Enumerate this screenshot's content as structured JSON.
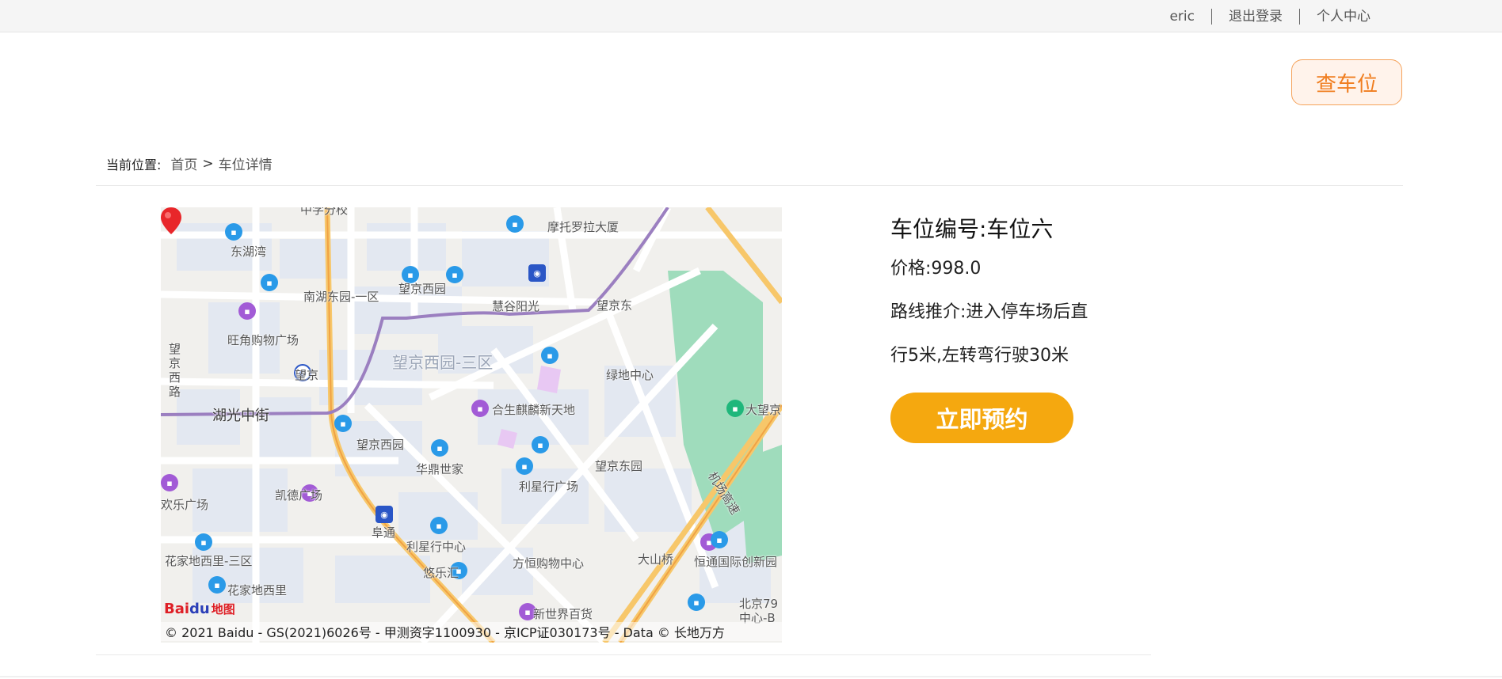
{
  "topbar": {
    "username": "eric",
    "logout": "退出登录",
    "profile": "个人中心"
  },
  "find_button": "查车位",
  "breadcrumb": {
    "label": "当前位置:",
    "home": "首页",
    "separator": ">",
    "current": "车位详情"
  },
  "map": {
    "labels": {
      "donghuwan": "东湖湾",
      "nanhu": "南湖东园-一区",
      "wangjing_xiyuan": "望京西园",
      "huigu": "慧谷阳光",
      "motorola": "摩托罗拉大厦",
      "wangjingdong": "望京东",
      "wangjiao": "旺角购物广场",
      "wangjing_west_road": "望京西路",
      "wangjing": "望京",
      "area_3": "望京西园-三区",
      "lvdi": "绿地中心",
      "huguang": "湖光中街",
      "hesheng": "合生麒麟新天地",
      "dawang": "大望京",
      "wangjing_xiyuan2": "望京西园",
      "huading": "华鼎世家",
      "lixing": "利星行广场",
      "wangjing_dongyuan": "望京东园",
      "jichang": "机场高速",
      "kaide": "凯德广场",
      "huanle": "欢乐广场",
      "futong": "阜通",
      "lixing_center": "利星行中心",
      "fangheng": "方恒购物中心",
      "huajia3": "花家地西里-三区",
      "huajia": "花家地西里",
      "dashanqiao": "大山桥",
      "hengtong": "恒通国际创新园",
      "youlehui": "悠乐汇",
      "xinshijie": "新世界百货",
      "beijing79": "北京79",
      "center_b": "中心-B",
      "zhongxue": "中学分校"
    },
    "logo": {
      "bai": "Bai",
      "du": "du",
      "ditu": "地图"
    },
    "copyright": "© 2021 Baidu - GS(2021)6026号 - 甲测资字1100930 - 京ICP证030173号 - Data © 长地万方"
  },
  "spot": {
    "title": "车位编号:车位六",
    "price": "价格:998.0",
    "route_line1": "路线推介:进入停车场后直",
    "route_line2": "行5米,左转弯行驶30米"
  },
  "reserve_button": "立即预约",
  "colors": {
    "accent_orange": "#f5a80f",
    "find_button_text": "#f07d1e",
    "route_purple": "#9b7fc0",
    "highway": "#f7c76a"
  }
}
